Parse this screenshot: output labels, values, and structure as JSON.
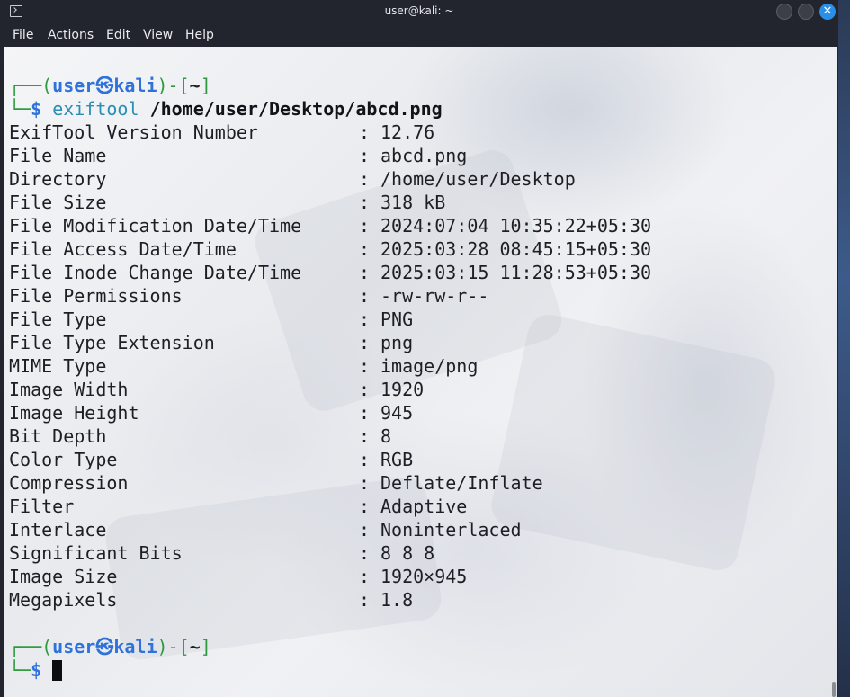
{
  "window": {
    "title": "user@kali: ~",
    "menu": [
      "File",
      "Actions",
      "Edit",
      "View",
      "Help"
    ],
    "close_glyph": "✕"
  },
  "prompt": {
    "user": "user",
    "separator_icon": "kali-dragon-icon",
    "host": "kali",
    "cwd": "~",
    "symbol": "$"
  },
  "command": {
    "program": "exiftool",
    "argument": "/home/user/Desktop/abcd.png"
  },
  "output": [
    {
      "key": "ExifTool Version Number",
      "value": "12.76"
    },
    {
      "key": "File Name",
      "value": "abcd.png"
    },
    {
      "key": "Directory",
      "value": "/home/user/Desktop"
    },
    {
      "key": "File Size",
      "value": "318 kB"
    },
    {
      "key": "File Modification Date/Time",
      "value": "2024:07:04 10:35:22+05:30"
    },
    {
      "key": "File Access Date/Time",
      "value": "2025:03:28 08:45:15+05:30"
    },
    {
      "key": "File Inode Change Date/Time",
      "value": "2025:03:15 11:28:53+05:30"
    },
    {
      "key": "File Permissions",
      "value": "-rw-rw-r--"
    },
    {
      "key": "File Type",
      "value": "PNG"
    },
    {
      "key": "File Type Extension",
      "value": "png"
    },
    {
      "key": "MIME Type",
      "value": "image/png"
    },
    {
      "key": "Image Width",
      "value": "1920"
    },
    {
      "key": "Image Height",
      "value": "945"
    },
    {
      "key": "Bit Depth",
      "value": "8"
    },
    {
      "key": "Color Type",
      "value": "RGB"
    },
    {
      "key": "Compression",
      "value": "Deflate/Inflate"
    },
    {
      "key": "Filter",
      "value": "Adaptive"
    },
    {
      "key": "Interlace",
      "value": "Noninterlaced"
    },
    {
      "key": "Significant Bits",
      "value": "8 8 8"
    },
    {
      "key": "Image Size",
      "value": "1920×945"
    },
    {
      "key": "Megapixels",
      "value": "1.8"
    }
  ],
  "colors": {
    "prompt_box": "#2d9a3f",
    "prompt_user": "#2f72d9",
    "command": "#2a8fb3",
    "close_button": "#2a8fe8"
  }
}
